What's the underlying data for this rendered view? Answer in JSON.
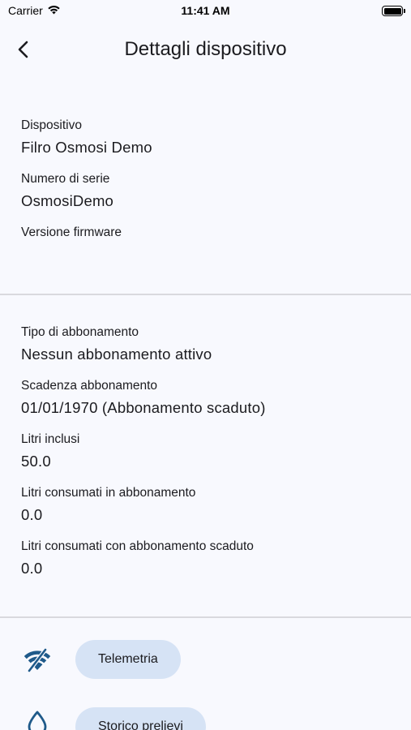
{
  "status_bar": {
    "carrier": "Carrier",
    "time": "11:41 AM"
  },
  "app_bar": {
    "title": "Dettagli dispositivo",
    "back_icon": "chevron-left-icon"
  },
  "device_section": {
    "fields": [
      {
        "label": "Dispositivo",
        "value": "Filro Osmosi Demo"
      },
      {
        "label": "Numero di serie",
        "value": "OsmosiDemo"
      },
      {
        "label": "Versione firmware",
        "value": ""
      }
    ]
  },
  "subscription_section": {
    "fields": [
      {
        "label": "Tipo di abbonamento",
        "value": "Nessun abbonamento attivo"
      },
      {
        "label": "Scadenza abbonamento",
        "value": "01/01/1970 (Abbonamento scaduto)"
      },
      {
        "label": "Litri inclusi",
        "value": "50.0"
      },
      {
        "label": "Litri consumati in abbonamento",
        "value": "0.0"
      },
      {
        "label": "Litri consumati con abbonamento scaduto",
        "value": "0.0"
      }
    ]
  },
  "actions": [
    {
      "icon": "wifi-off-icon",
      "label": "Telemetria"
    },
    {
      "icon": "water-drop-icon",
      "label": "Storico prelievi"
    }
  ],
  "colors": {
    "background": "#f8f9fe",
    "button_bg": "#d6e3f5",
    "icon_color": "#1f5a8a",
    "divider": "#d9d9de"
  }
}
